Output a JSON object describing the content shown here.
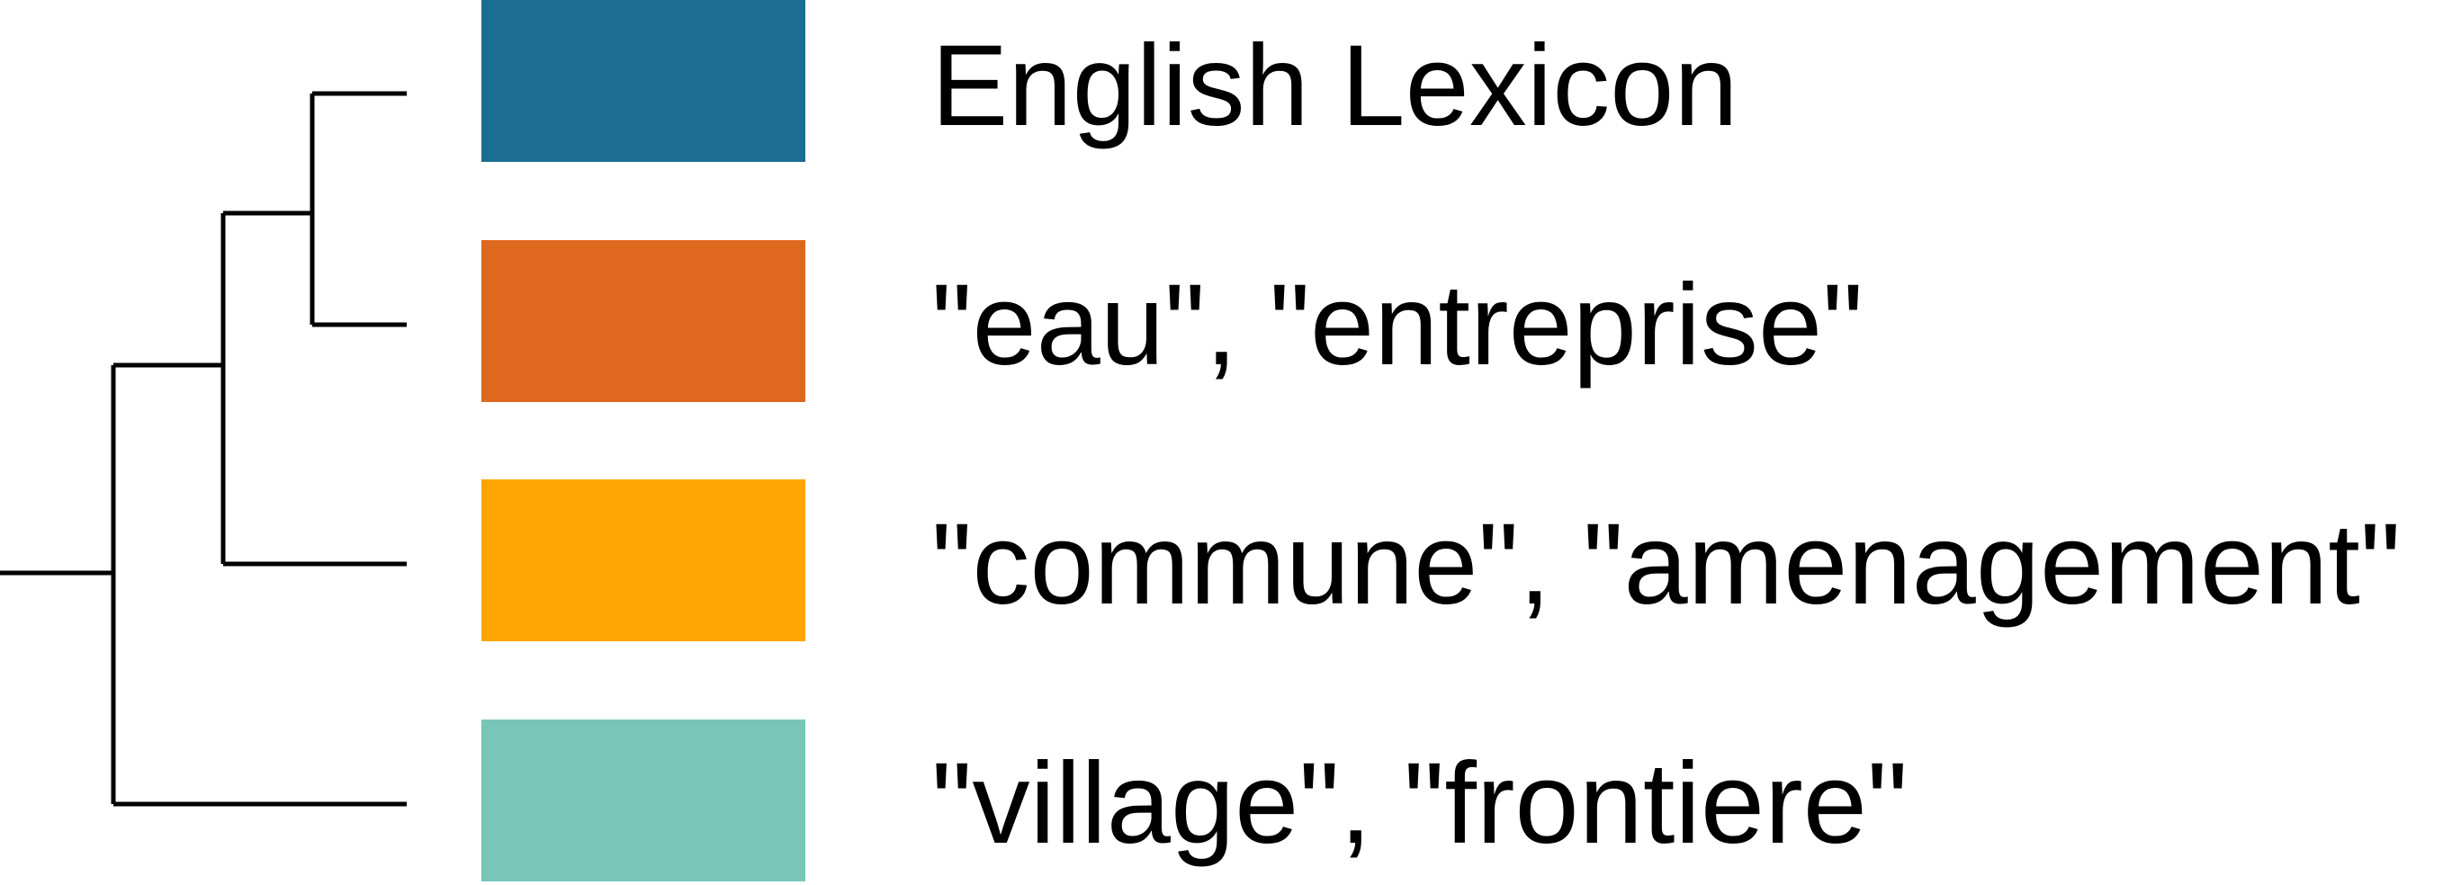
{
  "legend": {
    "items": [
      {
        "label": "English Lexicon",
        "color": "#1b6d91"
      },
      {
        "label": "\"eau\", \"entreprise\"",
        "color": "#de681e"
      },
      {
        "label": "\"commune\", \"amenagement\"",
        "color": "#ffa503"
      },
      {
        "label": "\"village\", \"frontiere\"",
        "color": "#77c6b8"
      }
    ]
  },
  "tree": {
    "merges": [
      {
        "children": [
          0,
          1
        ]
      },
      {
        "children": [
          "m0",
          2
        ]
      },
      {
        "children": [
          "m1",
          3
        ]
      }
    ],
    "line_color": "#000000"
  }
}
